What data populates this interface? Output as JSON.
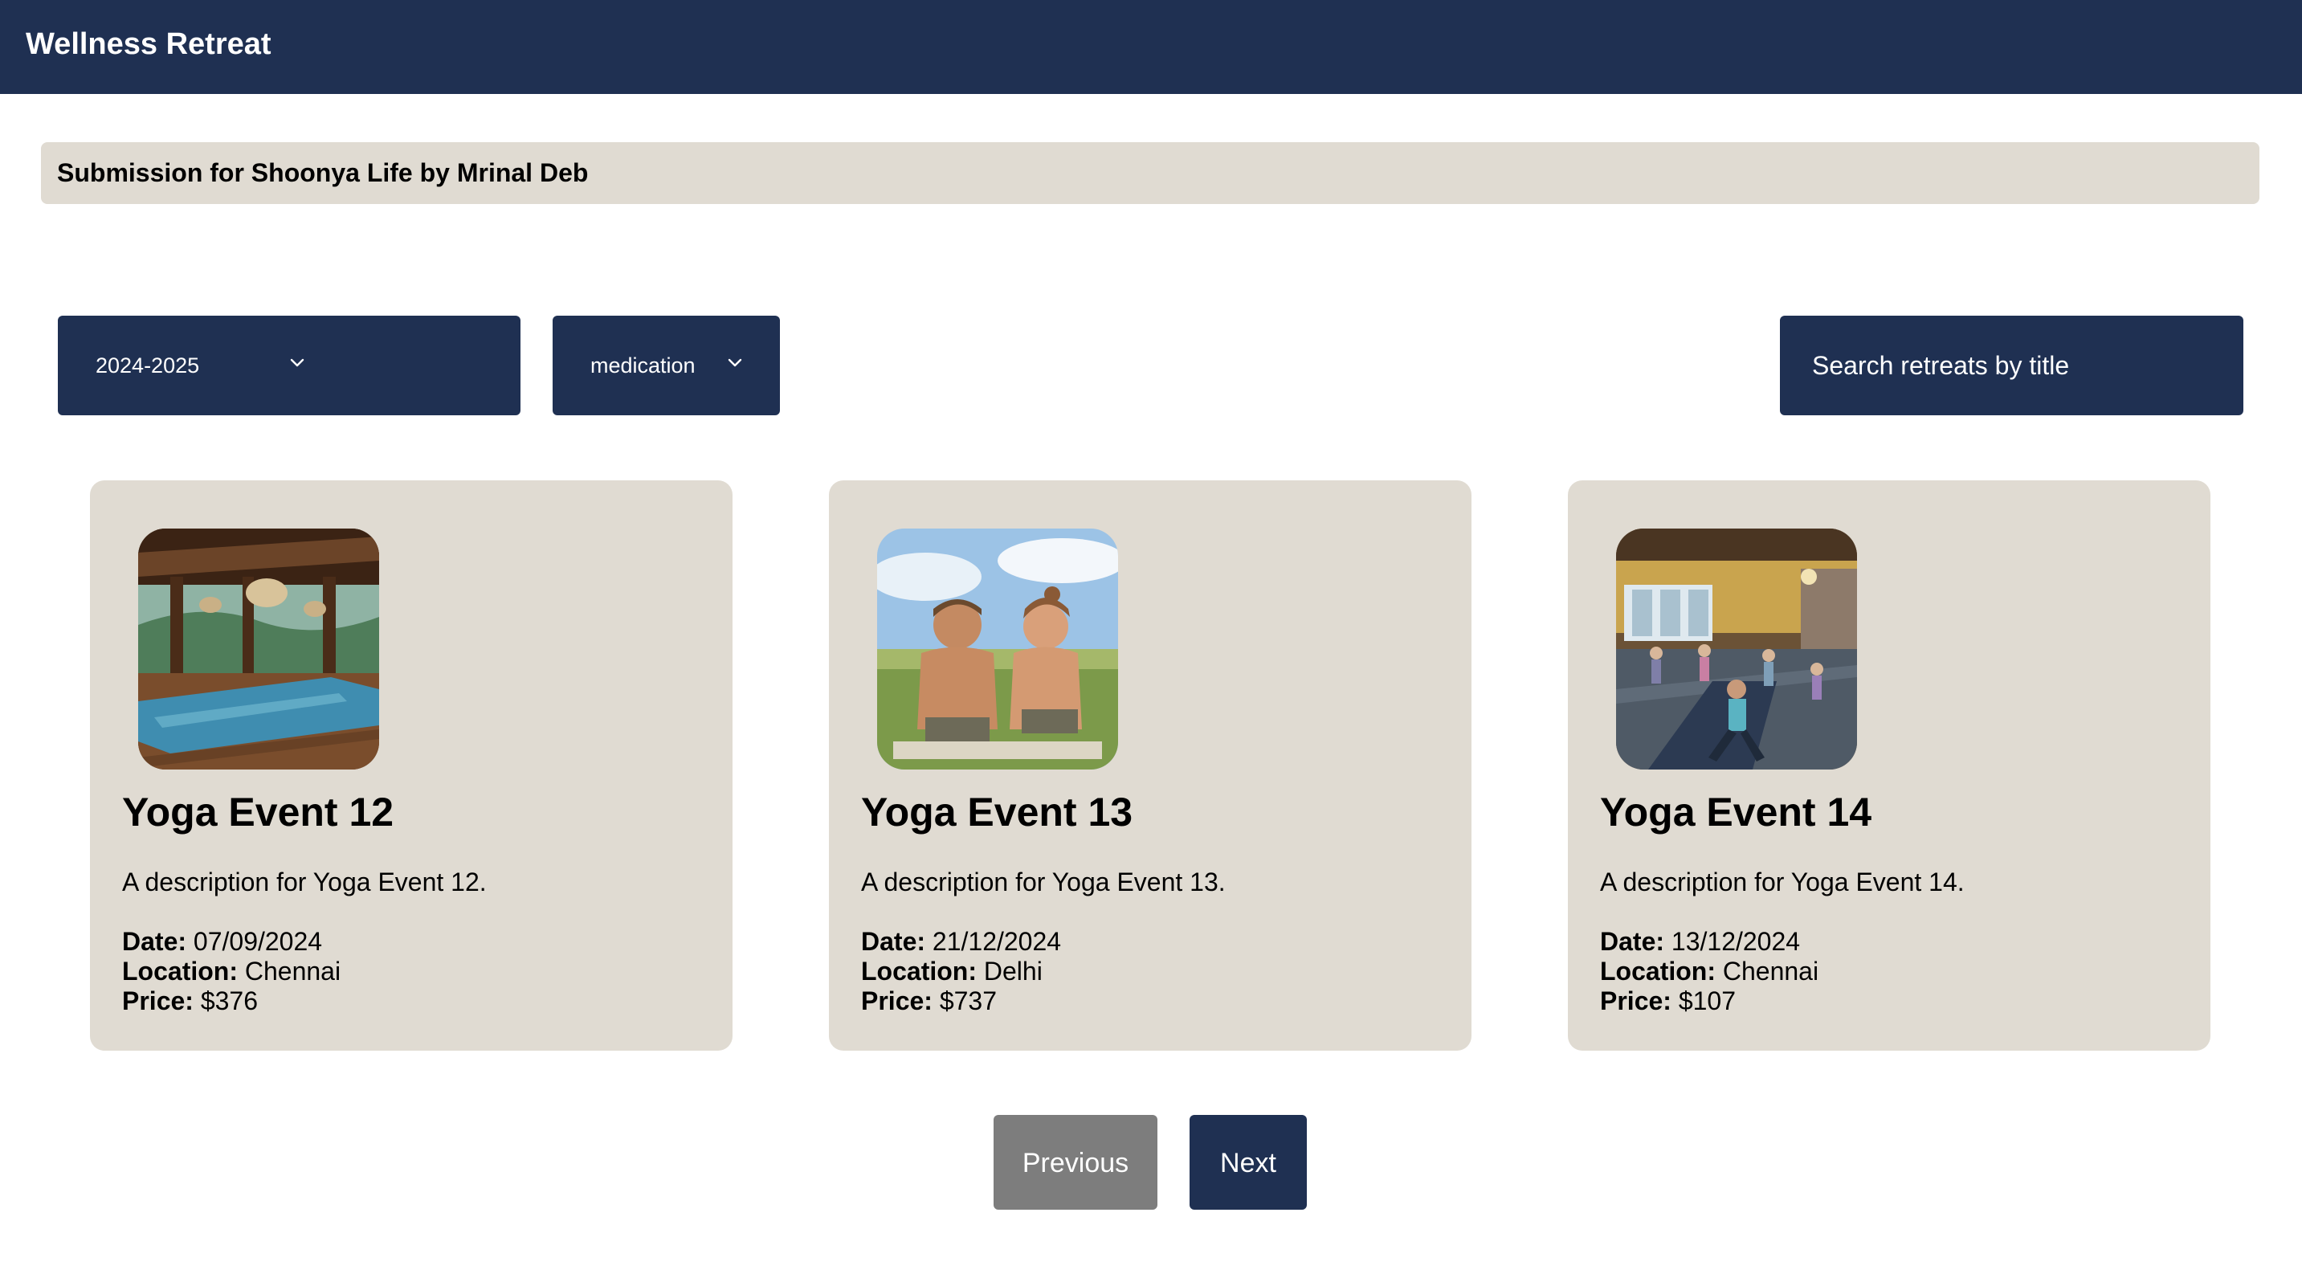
{
  "header": {
    "title": "Wellness Retreat"
  },
  "banner": {
    "text": "Submission for Shoonya Life by Mrinal Deb"
  },
  "filters": {
    "year": {
      "selected": "2024-2025"
    },
    "category": {
      "selected": "medication"
    },
    "search": {
      "placeholder": "Search retreats by title",
      "value": ""
    }
  },
  "labels": {
    "date": "Date:",
    "location": "Location:",
    "price": "Price:"
  },
  "cards": [
    {
      "title": "Yoga Event 12",
      "description": "A description for Yoga Event 12.",
      "date": "07/09/2024",
      "location": "Chennai",
      "price": "$376",
      "image": "yoga-pavilion-image"
    },
    {
      "title": "Yoga Event 13",
      "description": "A description for Yoga Event 13.",
      "date": "21/12/2024",
      "location": "Delhi",
      "price": "$737",
      "image": "couple-plank-meadow-image"
    },
    {
      "title": "Yoga Event 14",
      "description": "A description for Yoga Event 14.",
      "date": "13/12/2024",
      "location": "Chennai",
      "price": "$107",
      "image": "yoga-class-hall-image"
    }
  ],
  "pagination": {
    "previous": "Previous",
    "next": "Next"
  },
  "colors": {
    "navy": "#1f3052",
    "card": "#e0dbd2",
    "disabled": "#7d7d7d"
  }
}
